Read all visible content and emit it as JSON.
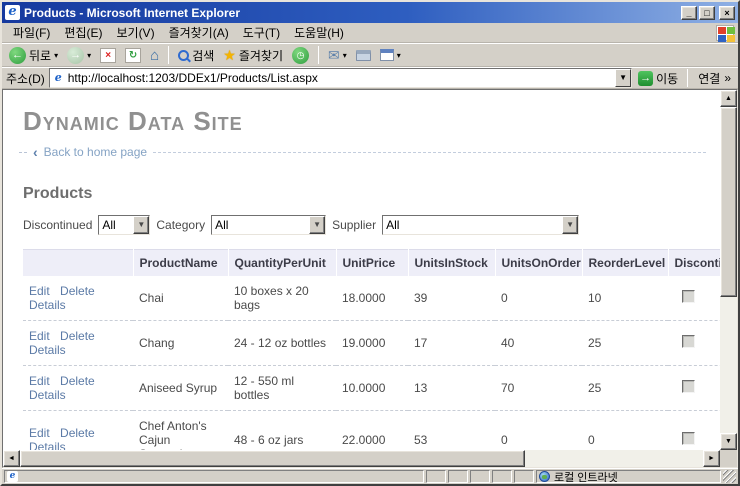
{
  "window": {
    "title": "Products - Microsoft Internet Explorer"
  },
  "menu": {
    "items": [
      "파일(F)",
      "편집(E)",
      "보기(V)",
      "즐겨찾기(A)",
      "도구(T)",
      "도움말(H)"
    ]
  },
  "toolbar": {
    "back_label": "뒤로",
    "search_label": "검색",
    "favorites_label": "즐겨찾기"
  },
  "address_bar": {
    "label": "주소(D)",
    "url": "http://localhost:1203/DDEx1/Products/List.aspx",
    "go_label": "이동",
    "links_label": "연결"
  },
  "page": {
    "site_title": "Dynamic Data Site",
    "back_link": "Back to home page",
    "heading": "Products",
    "filters": [
      {
        "label": "Discontinued",
        "value": "All"
      },
      {
        "label": "Category",
        "value": "All"
      },
      {
        "label": "Supplier",
        "value": "All"
      }
    ],
    "table": {
      "actions": [
        "Edit",
        "Delete",
        "Details"
      ],
      "columns": [
        "ProductName",
        "QuantityPerUnit",
        "UnitPrice",
        "UnitsInStock",
        "UnitsOnOrder",
        "ReorderLevel",
        "Discontinued"
      ],
      "rows": [
        {
          "cells": [
            "Chai",
            "10 boxes x 20 bags",
            "18.0000",
            "39",
            "0",
            "10"
          ],
          "discontinued": false
        },
        {
          "cells": [
            "Chang",
            "24 - 12 oz bottles",
            "19.0000",
            "17",
            "40",
            "25"
          ],
          "discontinued": false
        },
        {
          "cells": [
            "Aniseed Syrup",
            "12 - 550 ml bottles",
            "10.0000",
            "13",
            "70",
            "25"
          ],
          "discontinued": false
        },
        {
          "cells": [
            "Chef Anton's Cajun Seasoning",
            "48 - 6 oz jars",
            "22.0000",
            "53",
            "0",
            "0"
          ],
          "discontinued": false
        }
      ]
    }
  },
  "status_bar": {
    "zone_label": "로컬 인트라넷"
  },
  "icons": {
    "back_arrow": "←",
    "forward_arrow": "→",
    "stop_x": "×",
    "refresh": "↻",
    "home": "⌂",
    "history": "◷",
    "star": "★",
    "mail": "✉",
    "dropdown": "▾",
    "go_arrow": "→",
    "chevron_left": "‹",
    "chevrons_right": "»",
    "up_arrow": "▲",
    "down_arrow": "▼",
    "left_arrow": "◄",
    "right_arrow": "►",
    "minimize": "_",
    "maximize": "□",
    "close": "×",
    "ie_e": "e"
  },
  "colors": {
    "titlebar_start": "#16399e",
    "titlebar_end": "#8fb0e4",
    "chrome_gray": "#d4d0c8",
    "link_blue": "#5b7aa6",
    "table_header_bg": "#eeeef8",
    "site_title_gray": "#909090",
    "back_link_blue": "#85a3c4",
    "go_green": "#2fae3e"
  }
}
